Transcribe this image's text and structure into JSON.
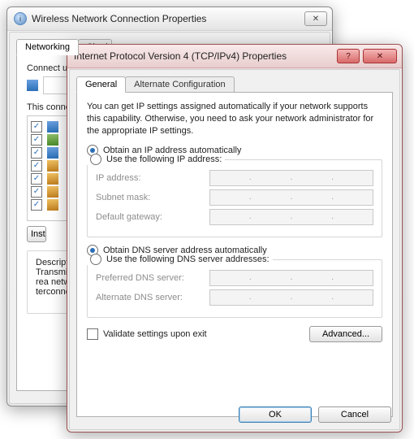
{
  "back": {
    "title": "Wireless Network Connection Properties",
    "tabs": {
      "active": "Networking",
      "other": "Sharing"
    },
    "connect_label": "Connect using:",
    "this_conn_label": "This connection uses the following items:",
    "install_btn": "Install...",
    "desc_label": "Description",
    "desc_text": "Transmission Control Protocol/Internet Protocol. The default wide area network protocol that provides communication across diverse interconnected networks."
  },
  "front": {
    "title": "Internet Protocol Version 4 (TCP/IPv4) Properties",
    "tabs": {
      "active": "General",
      "other": "Alternate Configuration"
    },
    "intro": "You can get IP settings assigned automatically if your network supports this capability. Otherwise, you need to ask your network administrator for the appropriate IP settings.",
    "ip": {
      "auto": "Obtain an IP address automatically",
      "manual": "Use the following IP address:",
      "addr": "IP address:",
      "mask": "Subnet mask:",
      "gw": "Default gateway:"
    },
    "dns": {
      "auto": "Obtain DNS server address automatically",
      "manual": "Use the following DNS server addresses:",
      "pref": "Preferred DNS server:",
      "alt": "Alternate DNS server:"
    },
    "validate": "Validate settings upon exit",
    "advanced": "Advanced...",
    "ok": "OK",
    "cancel": "Cancel"
  }
}
